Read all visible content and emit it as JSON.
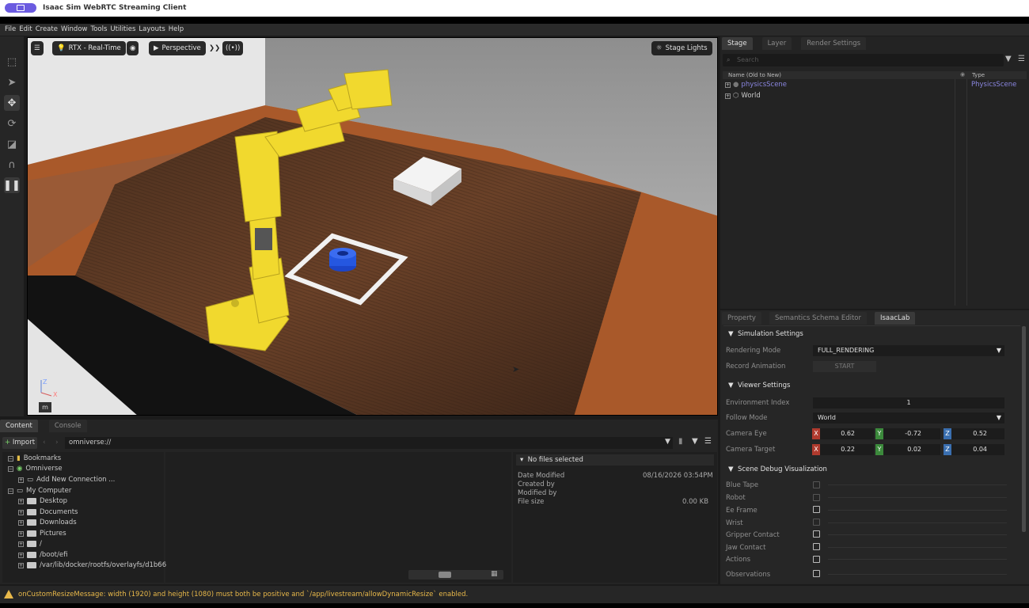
{
  "window": {
    "title": "Isaac Sim WebRTC Streaming Client"
  },
  "menu": [
    "File",
    "Edit",
    "Create",
    "Window",
    "Tools",
    "Utilities",
    "Layouts",
    "Help"
  ],
  "viewport": {
    "render_mode": "RTX - Real-Time",
    "camera": "Perspective",
    "lights": "Stage Lights",
    "units_badge": "m",
    "axis_z": "Z",
    "axis_x": "X"
  },
  "stage": {
    "tabs": [
      "Stage",
      "Layer",
      "Render Settings"
    ],
    "search_placeholder": "Search",
    "col_name": "Name (Old to New)",
    "col_type": "Type",
    "rows": [
      {
        "name": "physicsScene",
        "type": "PhysicsScene"
      },
      {
        "name": "World",
        "type": ""
      }
    ]
  },
  "property": {
    "tabs": [
      "Property",
      "Semantics Schema Editor",
      "IsaacLab"
    ],
    "simulation": {
      "title": "Simulation Settings",
      "rendering_mode_label": "Rendering Mode",
      "rendering_mode": "FULL_RENDERING",
      "record_label": "Record Animation",
      "record_button": "START"
    },
    "viewer": {
      "title": "Viewer Settings",
      "env_index_label": "Environment Index",
      "env_index": "1",
      "follow_label": "Follow Mode",
      "follow_mode": "World",
      "eye_label": "Camera Eye",
      "eye": [
        "0.62",
        "-0.72",
        "0.52"
      ],
      "target_label": "Camera Target",
      "target": [
        "0.22",
        "0.02",
        "0.04"
      ]
    },
    "debug": {
      "title": "Scene Debug Visualization",
      "items": [
        "Blue Tape",
        "Robot",
        "Ee Frame",
        "Wrist",
        "Gripper Contact",
        "Jaw Contact",
        "Actions",
        "Observations"
      ],
      "checked_bright": [
        false,
        false,
        true,
        false,
        true,
        true,
        true,
        true
      ]
    },
    "axis_labels": [
      "X",
      "Y",
      "Z"
    ]
  },
  "content": {
    "tabs": [
      "Content",
      "Console"
    ],
    "import": "Import",
    "path": "omniverse://",
    "tree": [
      "Bookmarks",
      "Omniverse",
      "Add New Connection ...",
      "My Computer",
      "Desktop",
      "Documents",
      "Downloads",
      "Pictures",
      "/",
      "/boot/efi",
      "/var/lib/docker/rootfs/overlayfs/d1b66"
    ],
    "details": {
      "header": "No files selected",
      "date_label": "Date Modified",
      "date": "08/16/2026 03:54PM",
      "created_label": "Created by",
      "modified_label": "Modified by",
      "size_label": "File size",
      "size": "0.00 KB"
    }
  },
  "status": {
    "message": "onCustomResizeMessage: width (1920) and height (1080) must both be positive and `/app/livestream/allowDynamicResize` enabled."
  },
  "colors": {
    "accent": "#6b5be0",
    "warning": "#e8b84a",
    "axis_x": "#c0392b",
    "axis_y": "#3c8a3c",
    "axis_z": "#3a6fb0"
  }
}
